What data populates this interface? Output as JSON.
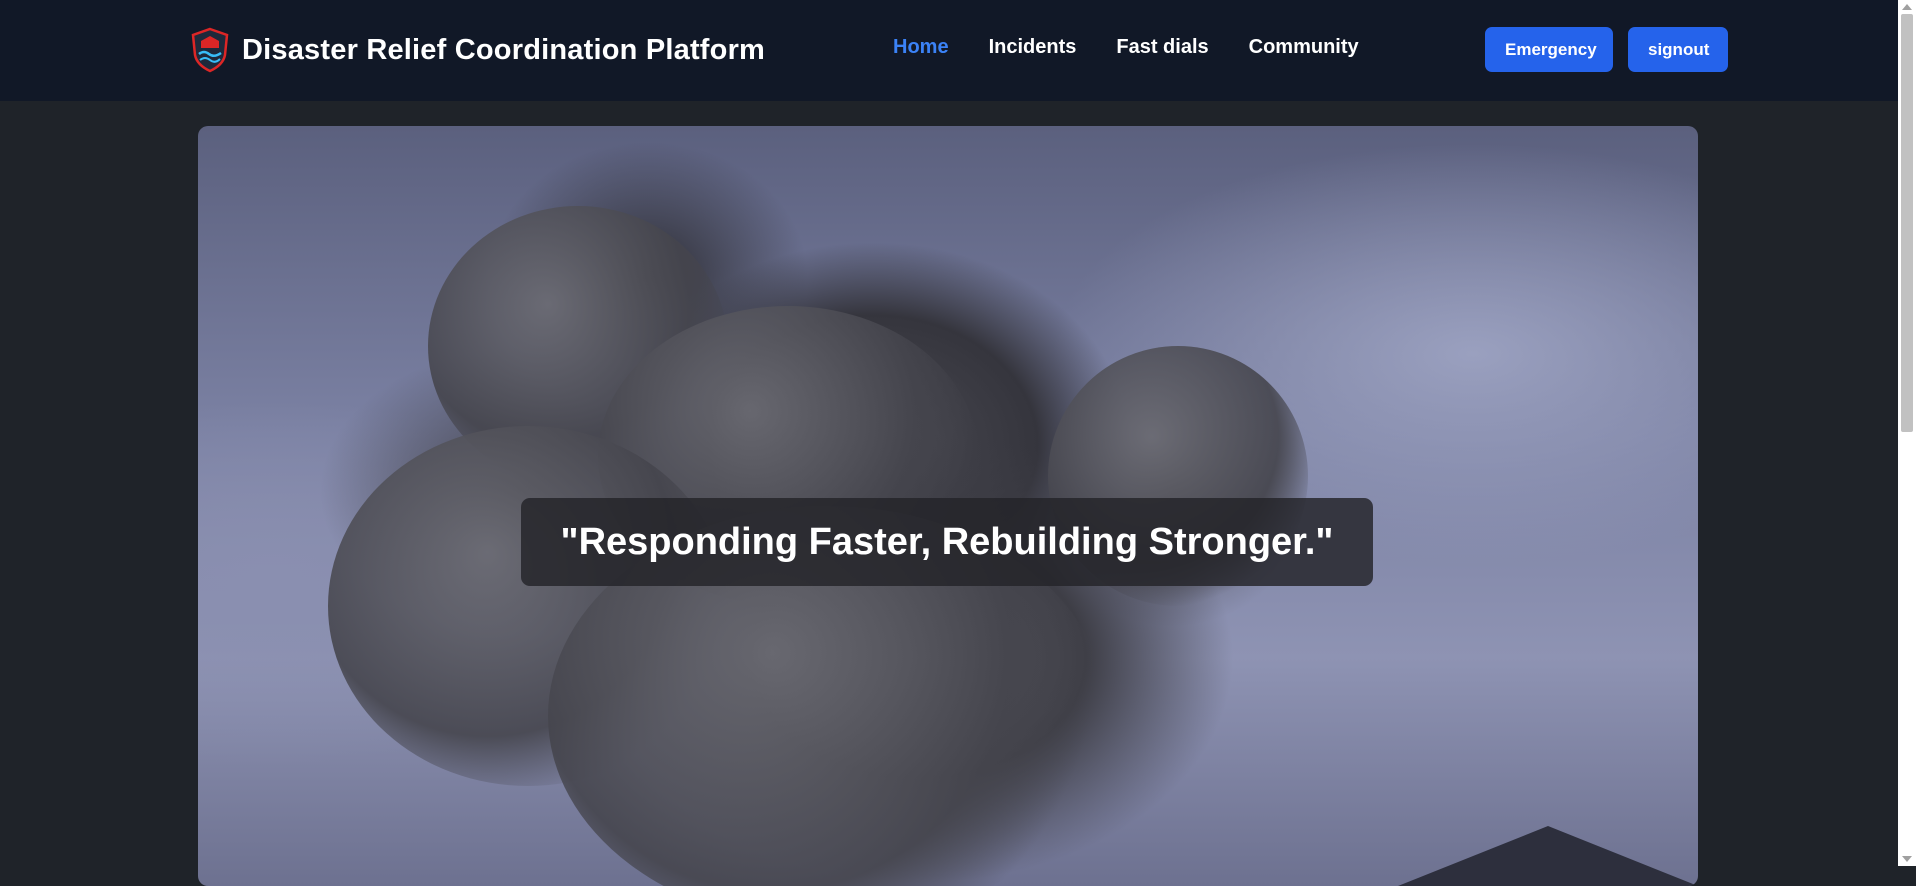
{
  "header": {
    "brand_title": "Disaster Relief Coordination Platform",
    "logo_icon": "shield-wave-icon",
    "nav": [
      {
        "label": "Home",
        "active": true
      },
      {
        "label": "Incidents",
        "active": false
      },
      {
        "label": "Fast dials",
        "active": false
      },
      {
        "label": "Community",
        "active": false
      }
    ],
    "buttons": {
      "emergency_label": "Emergency",
      "signout_label": "signout"
    }
  },
  "hero": {
    "quote": "\"Responding Faster, Rebuilding Stronger.\""
  },
  "colors": {
    "navbar_bg": "#111827",
    "page_bg": "#1f2329",
    "accent": "#2563eb",
    "active_link": "#3b82f6"
  }
}
